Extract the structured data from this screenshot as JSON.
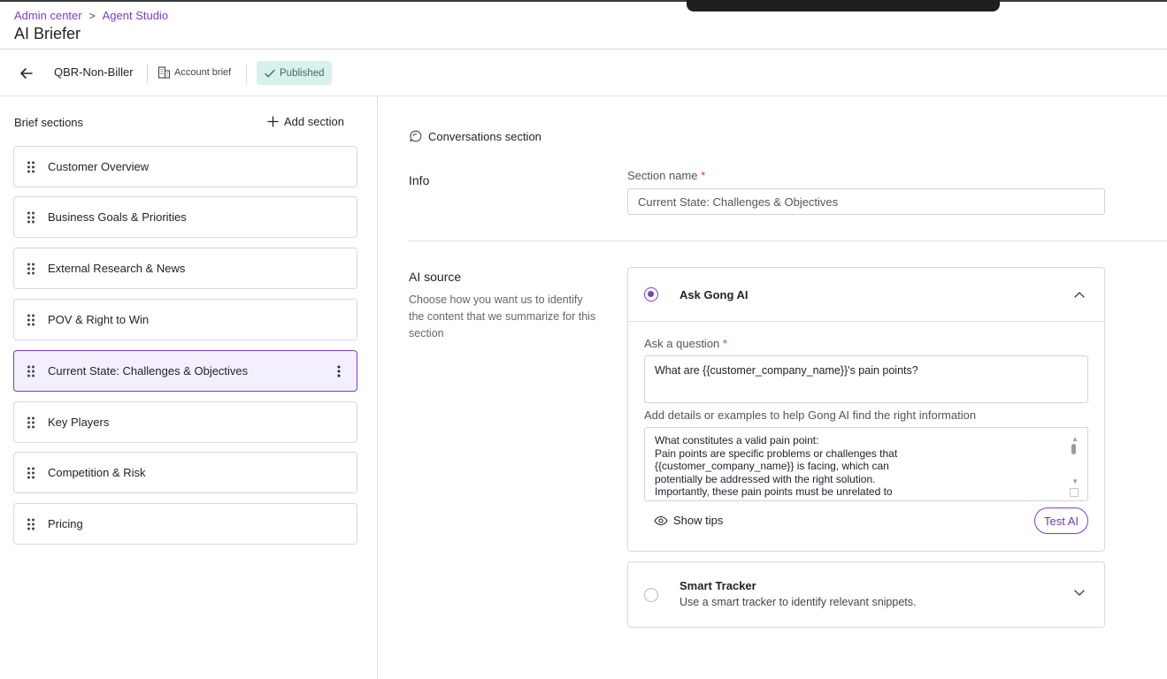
{
  "breadcrumb": {
    "items": [
      "Admin center",
      "Agent Studio"
    ],
    "separator": ">"
  },
  "page_title": "AI Briefer",
  "subbar": {
    "brief_name": "QBR-Non-Biller",
    "brief_type": "Account brief",
    "status": "Published"
  },
  "sidebar": {
    "title": "Brief sections",
    "add_section_label": "Add section",
    "sections": [
      {
        "label": "Customer Overview"
      },
      {
        "label": "Business Goals & Priorities"
      },
      {
        "label": "External Research & News"
      },
      {
        "label": "POV & Right to Win"
      },
      {
        "label": "Current State: Challenges & Objectives",
        "active": true
      },
      {
        "label": "Key Players"
      },
      {
        "label": "Competition & Risk"
      },
      {
        "label": "Pricing"
      }
    ]
  },
  "main": {
    "section_type": "Conversations section",
    "info_heading": "Info",
    "section_name_label": "Section name",
    "required_mark": "*",
    "section_name_value": "Current State: Challenges & Objectives",
    "ai_source_heading": "AI source",
    "ai_source_description": "Choose how you want us to identify the content that we summarize for this section",
    "ask_gong": {
      "title": "Ask Gong AI",
      "selected": true,
      "question_label": "Ask a question",
      "question_value": "What are {{customer_company_name}}'s pain points?",
      "details_label": "Add details or examples to help Gong AI find the right information",
      "details_value": "What constitutes a valid pain point:\nPain points are specific problems or challenges that\n{{customer_company_name}} is facing, which can\npotentially be addressed with the right solution.\nImportantly, these pain points must be unrelated to",
      "show_tips_label": "Show tips",
      "test_ai_label": "Test AI"
    },
    "smart_tracker": {
      "title": "Smart Tracker",
      "description": "Use a smart tracker to identify relevant snippets.",
      "selected": false
    }
  },
  "colors": {
    "accent": "#7b3fc4",
    "published_bg": "#d9f1ec",
    "published_fg": "#3a6e63",
    "required": "#d23b3b"
  },
  "icons": {
    "back": "arrow-left-icon",
    "type": "building-icon",
    "status": "check-icon",
    "add": "plus-icon",
    "drag": "drag-handle-icon",
    "more": "kebab-icon",
    "conversation": "conversation-icon",
    "collapse": "chevron-up-icon",
    "expand": "chevron-down-icon",
    "tips": "eye-icon"
  }
}
